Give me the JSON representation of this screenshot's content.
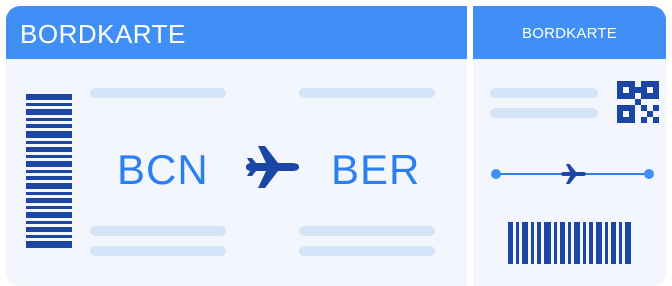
{
  "boarding_pass": {
    "main_title": "BORDKARTE",
    "stub_title": "BORDKARTE",
    "origin_code": "BCN",
    "destination_code": "BER"
  },
  "icons": [
    "barcode-icon",
    "airplane-icon",
    "qr-code-icon"
  ],
  "colors": {
    "header": "#3f8ff7",
    "background": "#f3f7fd",
    "placeholder_line": "#d4e4f9",
    "airport_code": "#2b7ff0",
    "dark_blue": "#1b46a4"
  }
}
